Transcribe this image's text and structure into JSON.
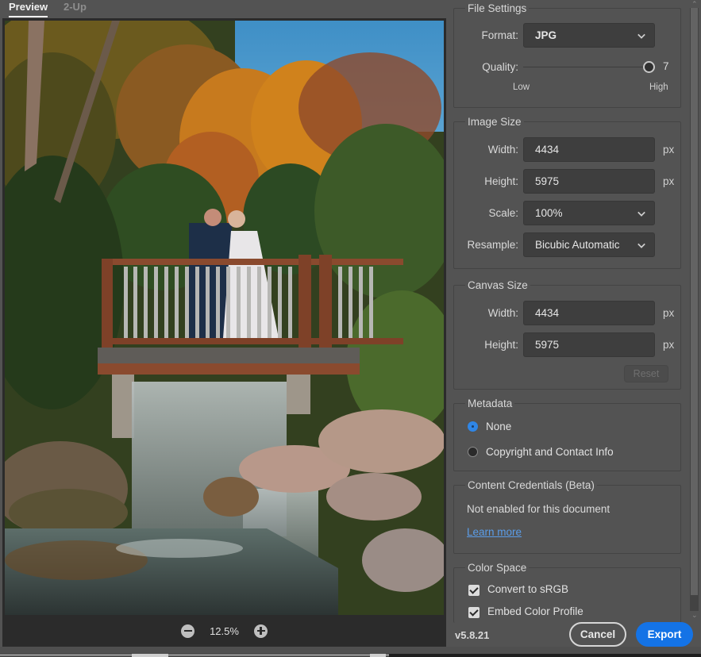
{
  "tabs": [
    {
      "label": "Preview",
      "active": true
    },
    {
      "label": "2-Up",
      "active": false
    }
  ],
  "preview": {
    "image_description": "Wedding couple kissing on wooden bridge above waterfall with autumn foliage",
    "zoom_level": "12.5%",
    "zoom_out_icon": "minus-circle-icon",
    "zoom_in_icon": "plus-circle-icon"
  },
  "file_settings": {
    "title": "File Settings",
    "format_label": "Format:",
    "format_value": "JPG",
    "quality_label": "Quality:",
    "quality_value": "7",
    "quality_fraction": 1.0,
    "quality_low": "Low",
    "quality_high": "High"
  },
  "image_size": {
    "title": "Image Size",
    "width_label": "Width:",
    "width_value": "4434",
    "height_label": "Height:",
    "height_value": "5975",
    "unit": "px",
    "scale_label": "Scale:",
    "scale_value": "100%",
    "resample_label": "Resample:",
    "resample_value": "Bicubic Automatic"
  },
  "canvas_size": {
    "title": "Canvas Size",
    "width_label": "Width:",
    "width_value": "4434",
    "height_label": "Height:",
    "height_value": "5975",
    "unit": "px",
    "reset_label": "Reset"
  },
  "metadata": {
    "title": "Metadata",
    "options": [
      {
        "label": "None",
        "selected": true
      },
      {
        "label": "Copyright and Contact Info",
        "selected": false
      }
    ]
  },
  "content_credentials": {
    "title": "Content Credentials (Beta)",
    "status": "Not enabled for this document",
    "link": "Learn more"
  },
  "color_space": {
    "title": "Color Space",
    "options": [
      {
        "label": "Convert to sRGB",
        "checked": true
      },
      {
        "label": "Embed Color Profile",
        "checked": true
      }
    ]
  },
  "footer": {
    "version": "v5.8.21",
    "cancel_label": "Cancel",
    "export_label": "Export"
  },
  "colors": {
    "accent": "#1473e6",
    "panel_bg": "#535353",
    "field_bg": "#3e3e3e",
    "link": "#5b9de8"
  }
}
